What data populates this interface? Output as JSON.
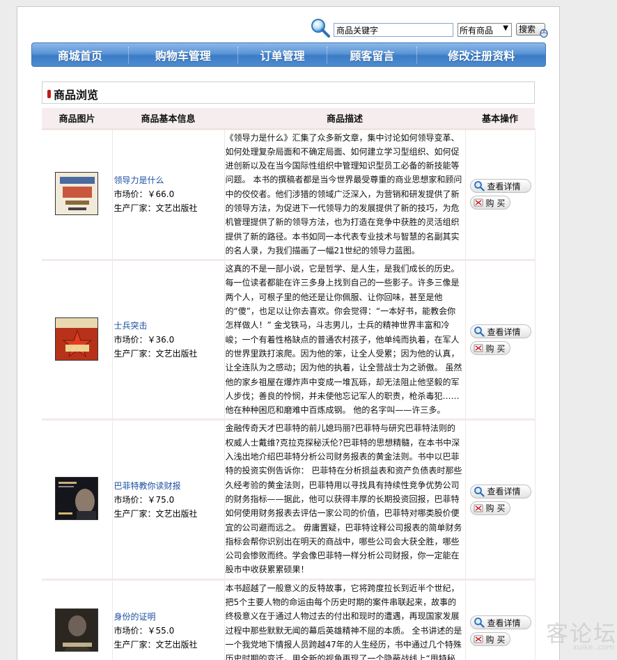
{
  "search": {
    "placeholder": "商品关键字",
    "value": "商品关键字",
    "category": "所有商品",
    "button_label": "搜索"
  },
  "nav": {
    "items": [
      {
        "label": "商城首页"
      },
      {
        "label": "购物车管理"
      },
      {
        "label": "订单管理"
      },
      {
        "label": "顾客留言"
      },
      {
        "label": "修改注册资料"
      }
    ]
  },
  "section": {
    "title": "商品浏览"
  },
  "table": {
    "headers": [
      "商品图片",
      "商品基本信息",
      "商品描述",
      "基本操作"
    ],
    "price_label": "市场价：",
    "maker_label": "生产厂家：",
    "detail_label": "查看详情",
    "buy_label": "购 买",
    "rows": [
      {
        "name": "领导力是什么",
        "price": "￥66.0",
        "maker": "文艺出版社",
        "description": "《领导力是什么》汇集了众多新文章，集中讨论如何领导变革、如何处理复杂局面和不确定局面、如何建立学习型组织、如何促进创新以及在当今国际性组织中管理知识型员工必备的新技能等问题。  本书的撰稿者都是当今世界最受尊重的商业思想家和顾问中的佼佼者。他们涉猎的领域广泛深入，为营销和研发提供了新的领导方法，为促进下一代领导力的发展提供了新的技巧，为危机管理提供了新的领导方法，也为打造在竞争中获胜的灵活组织提供了新的路径。本书如同一本代表专业技术与智慧的名副其实的名人录，为我们描画了一幅21世纪的领导力蓝图。",
        "cover_color": "#e9dcc4"
      },
      {
        "name": "士兵突击",
        "price": "￥36.0",
        "maker": "文艺出版社",
        "description": "这真的不是一部小说，它是哲学、是人生，是我们成长的历史。每一位读者都能在许三多身上找到自己的一些影子。许多三像是两个人，可根子里的他还是让你佩服、让你回味，甚至是他的“傻”，也足以让你去喜欢。你会觉得：“一本好书，能教会你怎样做人！”        金戈铁马，斗志男儿，士兵的精神世界丰富和冷峻；一个有着性格缺点的普通农村孩子，他单纯而执着，在军人的世界里跌打滚爬。因为他的笨，让全人受累；因为他的认真，让全连队为之感动；因为他的执着，让全营战士为之骄傲。        虽然他的家乡祖屋在爆炸声中变成一堆瓦砾，却无法阻止他坚毅的军人步伐；善良的怜悯，并未使他忘记军人的职责，枪杀毒犯……他在种种困厄和磨难中百炼成钢。        他的名字叫——许三多。",
        "cover_color": "#c23a1c"
      },
      {
        "name": "巴菲特教你读财报",
        "price": "￥75.0",
        "maker": "文艺出版社",
        "description": "金融传奇天才巴菲特的前儿媳玛丽?巴菲特与研究巴菲特法则的权威人士戴维?克拉克探秘沃伦?巴菲特的思想精髓，在本书中深入浅出地介绍巴菲特分析公司财务报表的黄金法则。书中以巴菲特的投资实例告诉你：        巴菲特在分析损益表和资产负债表时那些久经考验的黄金法则，巴菲特用以寻找具有持续性竞争优势公司的财务指标——据此，他可以获得丰厚的长期投资回报，巴菲特如何使用财务报表去评估一家公司的价值，巴菲特对哪类股价便宜的公司避而远之。        毋庸置疑，巴菲特诠释公司报表的简单财务指标会帮你识别出在明天的商战中，哪些公司会大获全胜，哪些公司会惨败而终。学会像巴菲特一样分析公司财报，你一定能在股市中收获累累硕果！",
        "cover_color": "#1a1a22"
      },
      {
        "name": "身份的证明",
        "price": "￥55.0",
        "maker": "文艺出版社",
        "description": "本书超越了一般意义的反特故事，它将跨度拉长到近半个世纪，把5个主要人物的命运由每个历史时期的案件串联起来，故事的终极意义在于通过人物过去的付出和现时的遭遇，再现国家发展过程中那些默默无闻的幕后英雄精神不屈的本质。  全书讲述的是一个我党地下情报人员跨越47年的人生经历，书中通过几个特殊历史时期的变迁，用全新的视角再现了一个隐蔽战线上“甩特秘材",
        "cover_color": "#2a2520"
      }
    ]
  },
  "watermark": {
    "text": "客论坛",
    "sub": "xuike..com"
  }
}
